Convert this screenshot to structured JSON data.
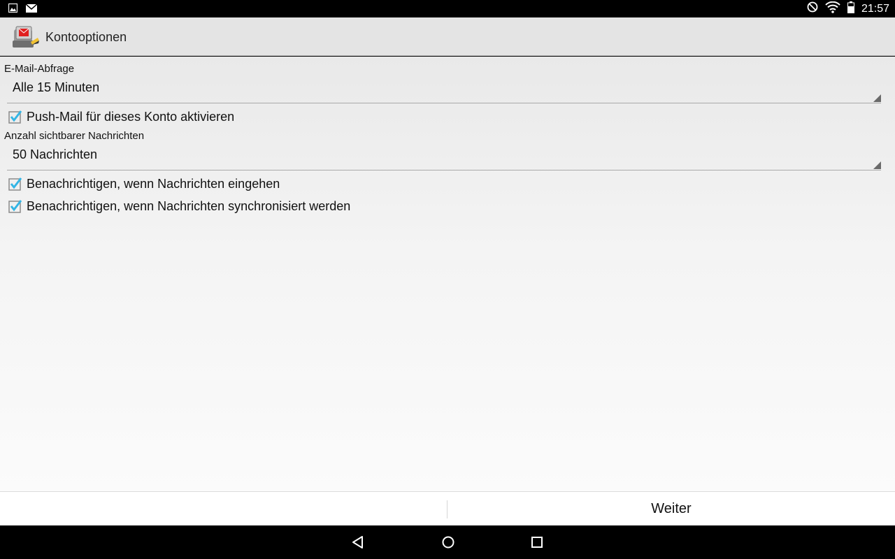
{
  "status_bar": {
    "time": "21:57",
    "icons": [
      "image-notification-icon",
      "mail-notification-icon",
      "do-not-disturb-icon",
      "wifi-icon",
      "battery-icon"
    ]
  },
  "action_bar": {
    "title": "Kontooptionen",
    "app_icon": "mail-app-icon"
  },
  "form": {
    "check_interval": {
      "label": "E-Mail-Abfrage",
      "value": "Alle 15 Minuten"
    },
    "push_mail": {
      "label": "Push-Mail für dieses Konto aktivieren",
      "checked": true
    },
    "visible_messages": {
      "label": "Anzahl sichtbarer Nachrichten",
      "value": "50 Nachrichten"
    },
    "notify_new": {
      "label": "Benachrichtigen, wenn Nachrichten eingehen",
      "checked": true
    },
    "notify_sync": {
      "label": "Benachrichtigen, wenn Nachrichten synchronisiert werden",
      "checked": true
    }
  },
  "buttons": {
    "next_label": "Weiter"
  },
  "colors": {
    "accent": "#33b5e5",
    "action_bar_bg": "#e4e4e4"
  },
  "nav": {
    "icons": [
      "back-icon",
      "home-icon",
      "recents-icon"
    ]
  }
}
